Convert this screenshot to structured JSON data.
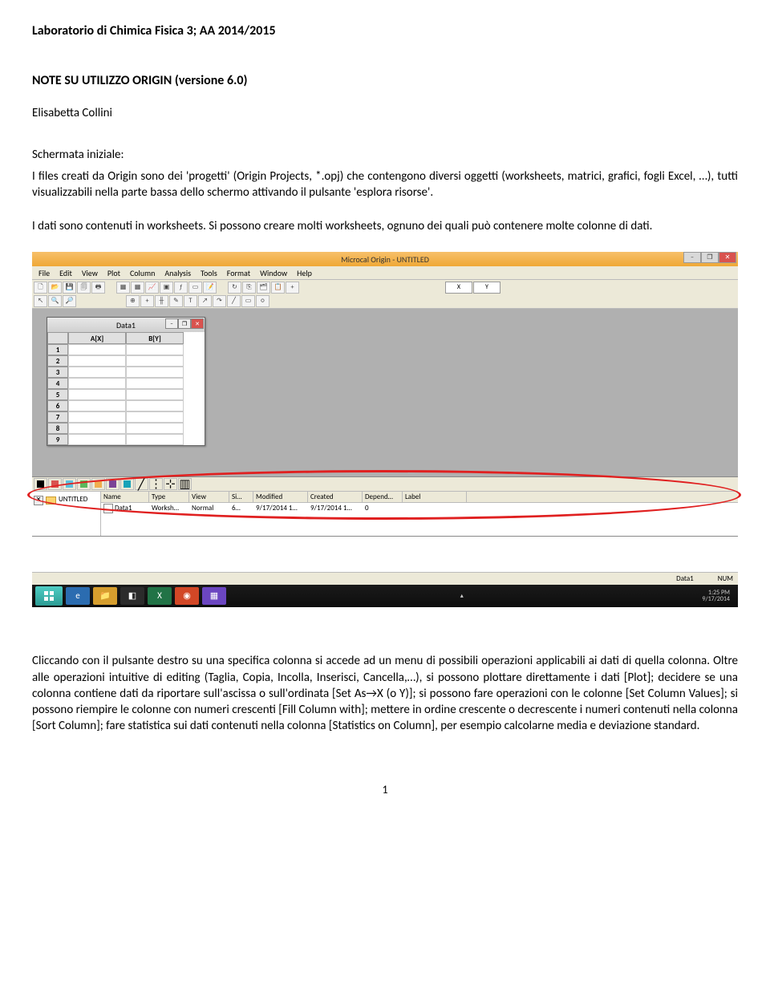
{
  "doc": {
    "header": "Laboratorio di Chimica Fisica 3; AA 2014/2015",
    "title": "NOTE SU UTILIZZO ORIGIN (versione 6.0)",
    "author": "Elisabetta Collini",
    "para1": "Schermata iniziale:",
    "para2": "I files creati da Origin sono dei 'progetti' (Origin Projects, *.opj) che contengono diversi oggetti (worksheets, matrici, grafici, fogli Excel, …), tutti visualizzabili nella parte bassa dello schermo attivando il pulsante 'esplora risorse'.",
    "para3": "I dati sono contenuti in worksheets. Si possono creare molti worksheets, ognuno dei quali può contenere molte colonne di dati.",
    "para4": "Cliccando con il pulsante destro su una specifica colonna si accede ad un menu di possibili operazioni applicabili ai dati di quella colonna. Oltre alle operazioni intuitive di editing (Taglia, Copia, Incolla, Inserisci, Cancella,…), si possono plottare direttamente i dati [Plot]; decidere se una colonna contiene dati da riportare sull'ascissa o sull'ordinata [Set As→X (o Y)]; si possono fare operazioni con le colonne [Set Column Values]; si possono riempire le colonne con numeri crescenti [Fill Column with]; mettere in ordine crescente o decrescente i numeri contenuti nella colonna [Sort Column]; fare statistica sui dati contenuti nella colonna [Statistics on Column], per esempio calcolarne media e deviazione standard.",
    "page_num": "1"
  },
  "app": {
    "titlebar": "Microcal Origin - UNTITLED",
    "menu": [
      "File",
      "Edit",
      "View",
      "Plot",
      "Column",
      "Analysis",
      "Tools",
      "Format",
      "Window",
      "Help"
    ],
    "sheet": {
      "title": "Data1",
      "colA": "A[X]",
      "colB": "B[Y]",
      "rows": [
        "1",
        "2",
        "3",
        "4",
        "5",
        "6",
        "7",
        "8",
        "9"
      ]
    },
    "pe": {
      "root": "UNTITLED",
      "headers": [
        "Name",
        "Type",
        "View",
        "Si…",
        "Modified",
        "Created",
        "Depend…",
        "Label"
      ],
      "row": {
        "name": "Data1",
        "type": "Worksh…",
        "view": "Normal",
        "size": "6…",
        "modified": "9/17/2014 1…",
        "created": "9/17/2014 1…",
        "depend": "0",
        "label": ""
      }
    },
    "status": {
      "left": "Data1",
      "right": "NUM"
    },
    "taskbar": {
      "time": "1:25 PM",
      "date": "9/17/2014"
    },
    "graph_colors": [
      "#000000",
      "#d9534f",
      "#5bc0de",
      "#5cb85c",
      "#f0ad4e",
      "#7b4397",
      "#17a2b8",
      "#343a40",
      "#6c757d",
      "#ffffff"
    ]
  }
}
